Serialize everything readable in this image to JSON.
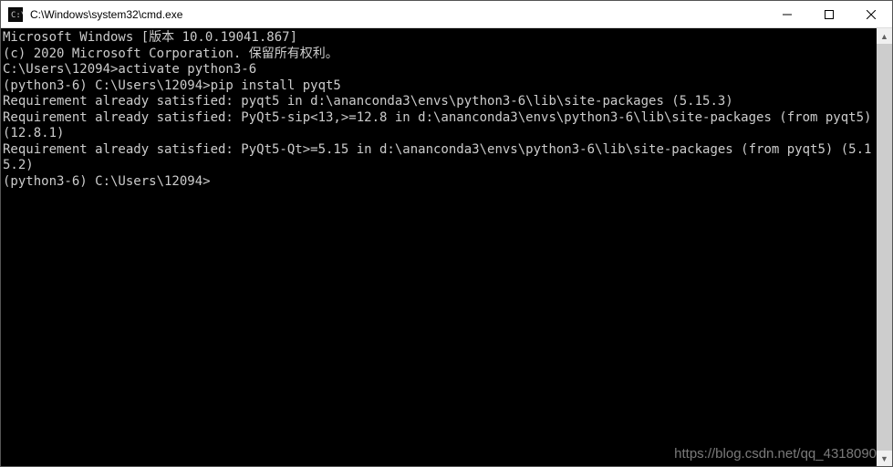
{
  "window": {
    "title": "C:\\Windows\\system32\\cmd.exe"
  },
  "terminal": {
    "lines": [
      "Microsoft Windows [版本 10.0.19041.867]",
      "(c) 2020 Microsoft Corporation. 保留所有权利。",
      "",
      "C:\\Users\\12094>activate python3-6",
      "",
      "(python3-6) C:\\Users\\12094>pip install pyqt5",
      "Requirement already satisfied: pyqt5 in d:\\ananconda3\\envs\\python3-6\\lib\\site-packages (5.15.3)",
      "Requirement already satisfied: PyQt5-sip<13,>=12.8 in d:\\ananconda3\\envs\\python3-6\\lib\\site-packages (from pyqt5) (12.8.1)",
      "Requirement already satisfied: PyQt5-Qt>=5.15 in d:\\ananconda3\\envs\\python3-6\\lib\\site-packages (from pyqt5) (5.15.2)",
      "",
      "(python3-6) C:\\Users\\12094>"
    ]
  },
  "watermark": "https://blog.csdn.net/qq_4318090"
}
